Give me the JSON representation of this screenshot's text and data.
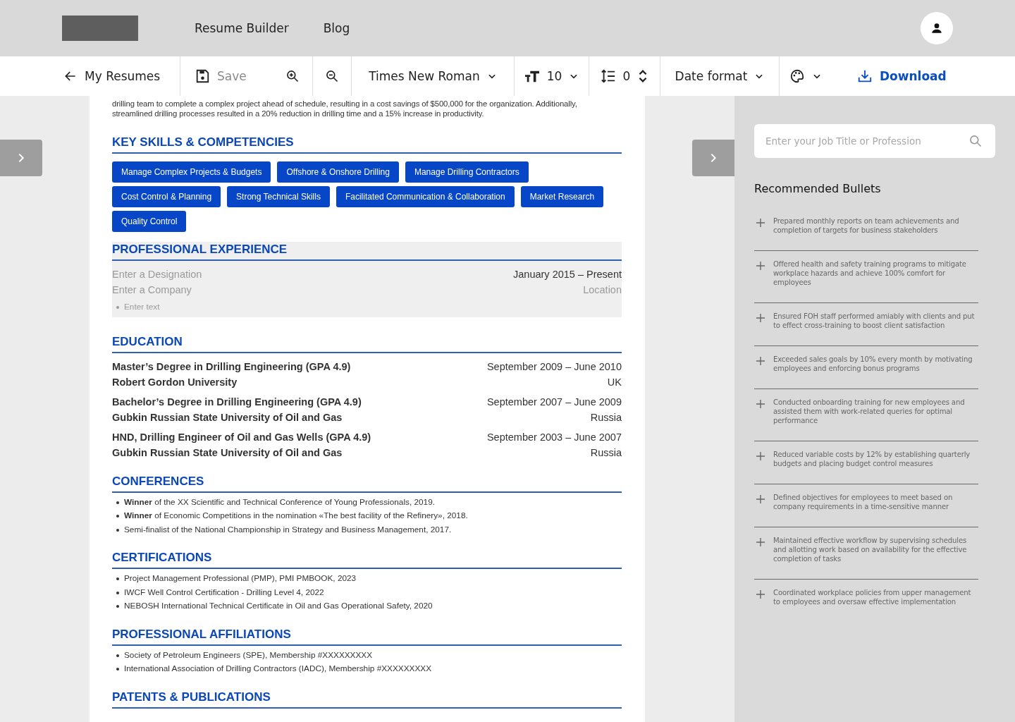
{
  "nav": {
    "links": [
      "Resume Builder",
      "Blog"
    ]
  },
  "toolbar": {
    "back": "My Resumes",
    "save": {
      "label": "Save",
      "disabled": true
    },
    "font": "Times New Roman",
    "size": "10",
    "spacing": "0",
    "date_format": "Date format",
    "download": "Download"
  },
  "resume": {
    "intro_lines": [
      "drilling team to complete a complex project ahead of schedule, resulting in a cost savings of $500,000 for the organization. Additionally,",
      "streamlined drilling processes resulted in a 20% reduction in drilling time and a 15% increase in productivity."
    ],
    "sections": [
      {
        "kind": "skills",
        "title": "KEY SKILLS & COMPETENCIES",
        "skills": [
          "Manage Complex Projects & Budgets",
          "Offshore & Onshore Drilling",
          "Manage Drilling Contractors",
          "Cost Control & Planning",
          "Strong Technical Skills",
          "Facilitated Communication & Collaboration",
          "Market Research",
          "Quality Control"
        ]
      },
      {
        "kind": "experience",
        "title": "PROFESSIONAL EXPERIENCE",
        "entry": {
          "designation": {
            "placeholder": "Enter a Designation"
          },
          "dates": "January 2015 – Present",
          "company": {
            "placeholder": "Enter a Company"
          },
          "location": {
            "placeholder": "Location"
          },
          "bullet": {
            "placeholder": "Enter text"
          }
        }
      },
      {
        "kind": "education",
        "title": "EDUCATION",
        "entries": [
          {
            "degree": "Master’s Degree in Drilling Engineering (GPA 4.9)",
            "dates": "September 2009 – June 2010",
            "school": "Robert Gordon University",
            "location": "UK"
          },
          {
            "degree": "Bachelor’s Degree in Drilling Engineering (GPA 4.9)",
            "dates": "September 2007 – June 2009",
            "school": "Gubkin Russian State University of Oil and Gas",
            "location": "Russia"
          },
          {
            "degree": "HND, Drilling Engineer of Oil and Gas Wells (GPA 4.9)",
            "dates": "September 2003 – June 2007",
            "school": "Gubkin Russian State University of Oil and Gas",
            "location": "Russia"
          }
        ]
      },
      {
        "kind": "list",
        "title": "CONFERENCES",
        "items": [
          "**Winner** of the XX Scientific and Technical Conference of Young Professionals, 2019.",
          "**Winner** of Economic Competitions in the nomination «The best facility of the Refinery», 2018.",
          "Semi-finalist of the National Championship in Strategy and Business Management, 2017."
        ]
      },
      {
        "kind": "list",
        "title": "CERTIFICATIONS",
        "items": [
          "Project Management Professional (PMP), PMI PMBOOK, 2023",
          "IWCF Well Control Certification - Drilling Level 4, 2022",
          "NEBOSH International Technical Certificate in Oil and Gas Operational Safety, 2020"
        ]
      },
      {
        "kind": "list",
        "title": "PROFESSIONAL AFFILIATIONS",
        "items": [
          "Society of Petroleum Engineers (SPE), Membership #XXXXXXXXX",
          "International Association of Drilling Contractors (IADC), Membership #XXXXXXXXX"
        ]
      },
      {
        "kind": "list",
        "title": "PATENTS & PUBLICATIONS"
      }
    ]
  },
  "panel": {
    "search": {
      "placeholder": "Enter your Job Title or Profession"
    },
    "title": "Recommended Bullets",
    "bullets": [
      "Prepared monthly reports on team achievements and completion of targets for business stakeholders",
      "Offered health and safety training programs to mitigate workplace hazards and achieve 100% comfort for employees",
      "Ensured FOH staff performed amiably with clients and put to effect cross-training to boost client satisfaction",
      "Exceeded sales goals by 10% every month by motivating employees and enforcing bonus programs",
      "Conducted onboarding training for new employees and assisted them with work-related queries for optimal performance",
      "Reduced variable costs by 12% by establishing quarterly budgets and placing budget control measures",
      "Defined objectives for employees to meet based on company requirements in a time-sensitive manner",
      "Maintained effective workflow by supervising schedules and allotting work based on availability for the effective completion of tasks",
      "Coordinated workplace policies from upper management to employees and oversaw effective implementation"
    ]
  }
}
